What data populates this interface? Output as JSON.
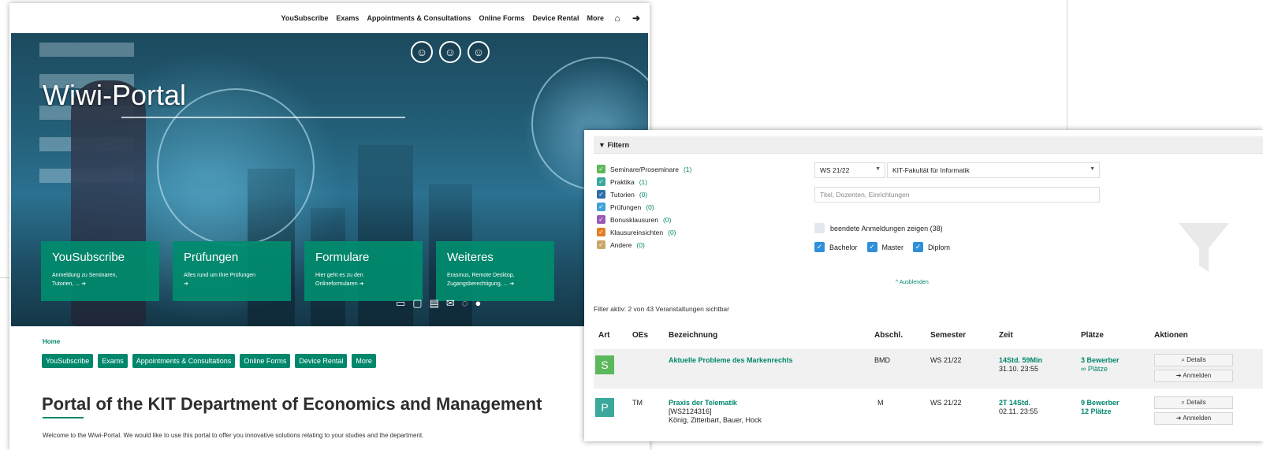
{
  "portal": {
    "nav": [
      "YouSubscribe",
      "Exams",
      "Appointments & Consultations",
      "Online Forms",
      "Device Rental",
      "More"
    ],
    "hero_title": "Wiwi-Portal",
    "tiles": [
      {
        "title": "YouSubscribe",
        "desc1": "Anmeldung zu Seminaren,",
        "desc2": "Tutorien, ... ➔"
      },
      {
        "title": "Prüfungen",
        "desc1": "Alles rund um Ihre Prüfungen",
        "desc2": "➔"
      },
      {
        "title": "Formulare",
        "desc1": "Hier geht es zu den",
        "desc2": "Onlineformularen ➔"
      },
      {
        "title": "Weiteres",
        "desc1": "Erasmus, Remote Desktop,",
        "desc2": "Zugangsberechtigung, ... ➔"
      }
    ],
    "breadcrumb": "Home",
    "pills": [
      "YouSubscribe",
      "Exams",
      "Appointments & Consultations",
      "Online Forms",
      "Device Rental",
      "More"
    ],
    "page_title": "Portal of the KIT Department of Economics and Management",
    "welcome": "Welcome to the Wiwi-Portal. We would like to use this portal to offer you innovative solutions relating to your studies and the department."
  },
  "filter": {
    "header": "Filtern",
    "categories": [
      {
        "label": "Seminare/Proseminare",
        "count": "(1)",
        "color": "#5cb85c",
        "checked": true
      },
      {
        "label": "Praktika",
        "count": "(1)",
        "color": "#3aa89a",
        "checked": true
      },
      {
        "label": "Tutorien",
        "count": "(0)",
        "color": "#2f6fa8",
        "checked": true
      },
      {
        "label": "Prüfungen",
        "count": "(0)",
        "color": "#3fa2d8",
        "checked": true
      },
      {
        "label": "Bonusklausuren",
        "count": "(0)",
        "color": "#9b59b6",
        "checked": true
      },
      {
        "label": "Klausureinsichten",
        "count": "(0)",
        "color": "#e67e22",
        "checked": true
      },
      {
        "label": "Andere",
        "count": "(0)",
        "color": "#c9a86a",
        "checked": true
      }
    ],
    "semester": "WS 21/22",
    "faculty": "KIT-Fakultät für Informatik",
    "search_placeholder": "Titel, Dozenten, Einrichtungen",
    "show_finished": "beendete Anmeldungen zeigen (38)",
    "degrees": [
      "Bachelor",
      "Master",
      "Diplom"
    ],
    "collapse": "^ Ausblenden",
    "active_info": "Filter aktiv: 2 von 43 Veranstaltungen sichtbar"
  },
  "table": {
    "headers": [
      "Art",
      "OEs",
      "Bezeichnung",
      "Abschl.",
      "Semester",
      "Zeit",
      "Plätze",
      "Aktionen"
    ],
    "rows": [
      {
        "art": "S",
        "art_color": "#5cb85c",
        "oes": "",
        "title": "Aktuelle Probleme des Markenrechts",
        "sub1": "",
        "sub2": "",
        "abschl": "BMD",
        "semester": "WS 21/22",
        "time_left": "14Std. 59Min",
        "time_date": "31.10. 23:55",
        "places1": "3 Bewerber",
        "places2": "∞ Plätze",
        "btn_details": "Details",
        "btn_register": "Anmelden"
      },
      {
        "art": "P",
        "art_color": "#3aa89a",
        "oes": "TM",
        "title": "Praxis der Telematik",
        "sub1": "[WS2124316]",
        "sub2": "König, Zitterbart, Bauer, Hock",
        "abschl": "M",
        "semester": "WS 21/22",
        "time_left": "2T 14Std.",
        "time_date": "02.11. 23:55",
        "places1": "9 Bewerber",
        "places2": "12 Plätze",
        "btn_details": "Details",
        "btn_register": "Anmelden"
      }
    ]
  }
}
